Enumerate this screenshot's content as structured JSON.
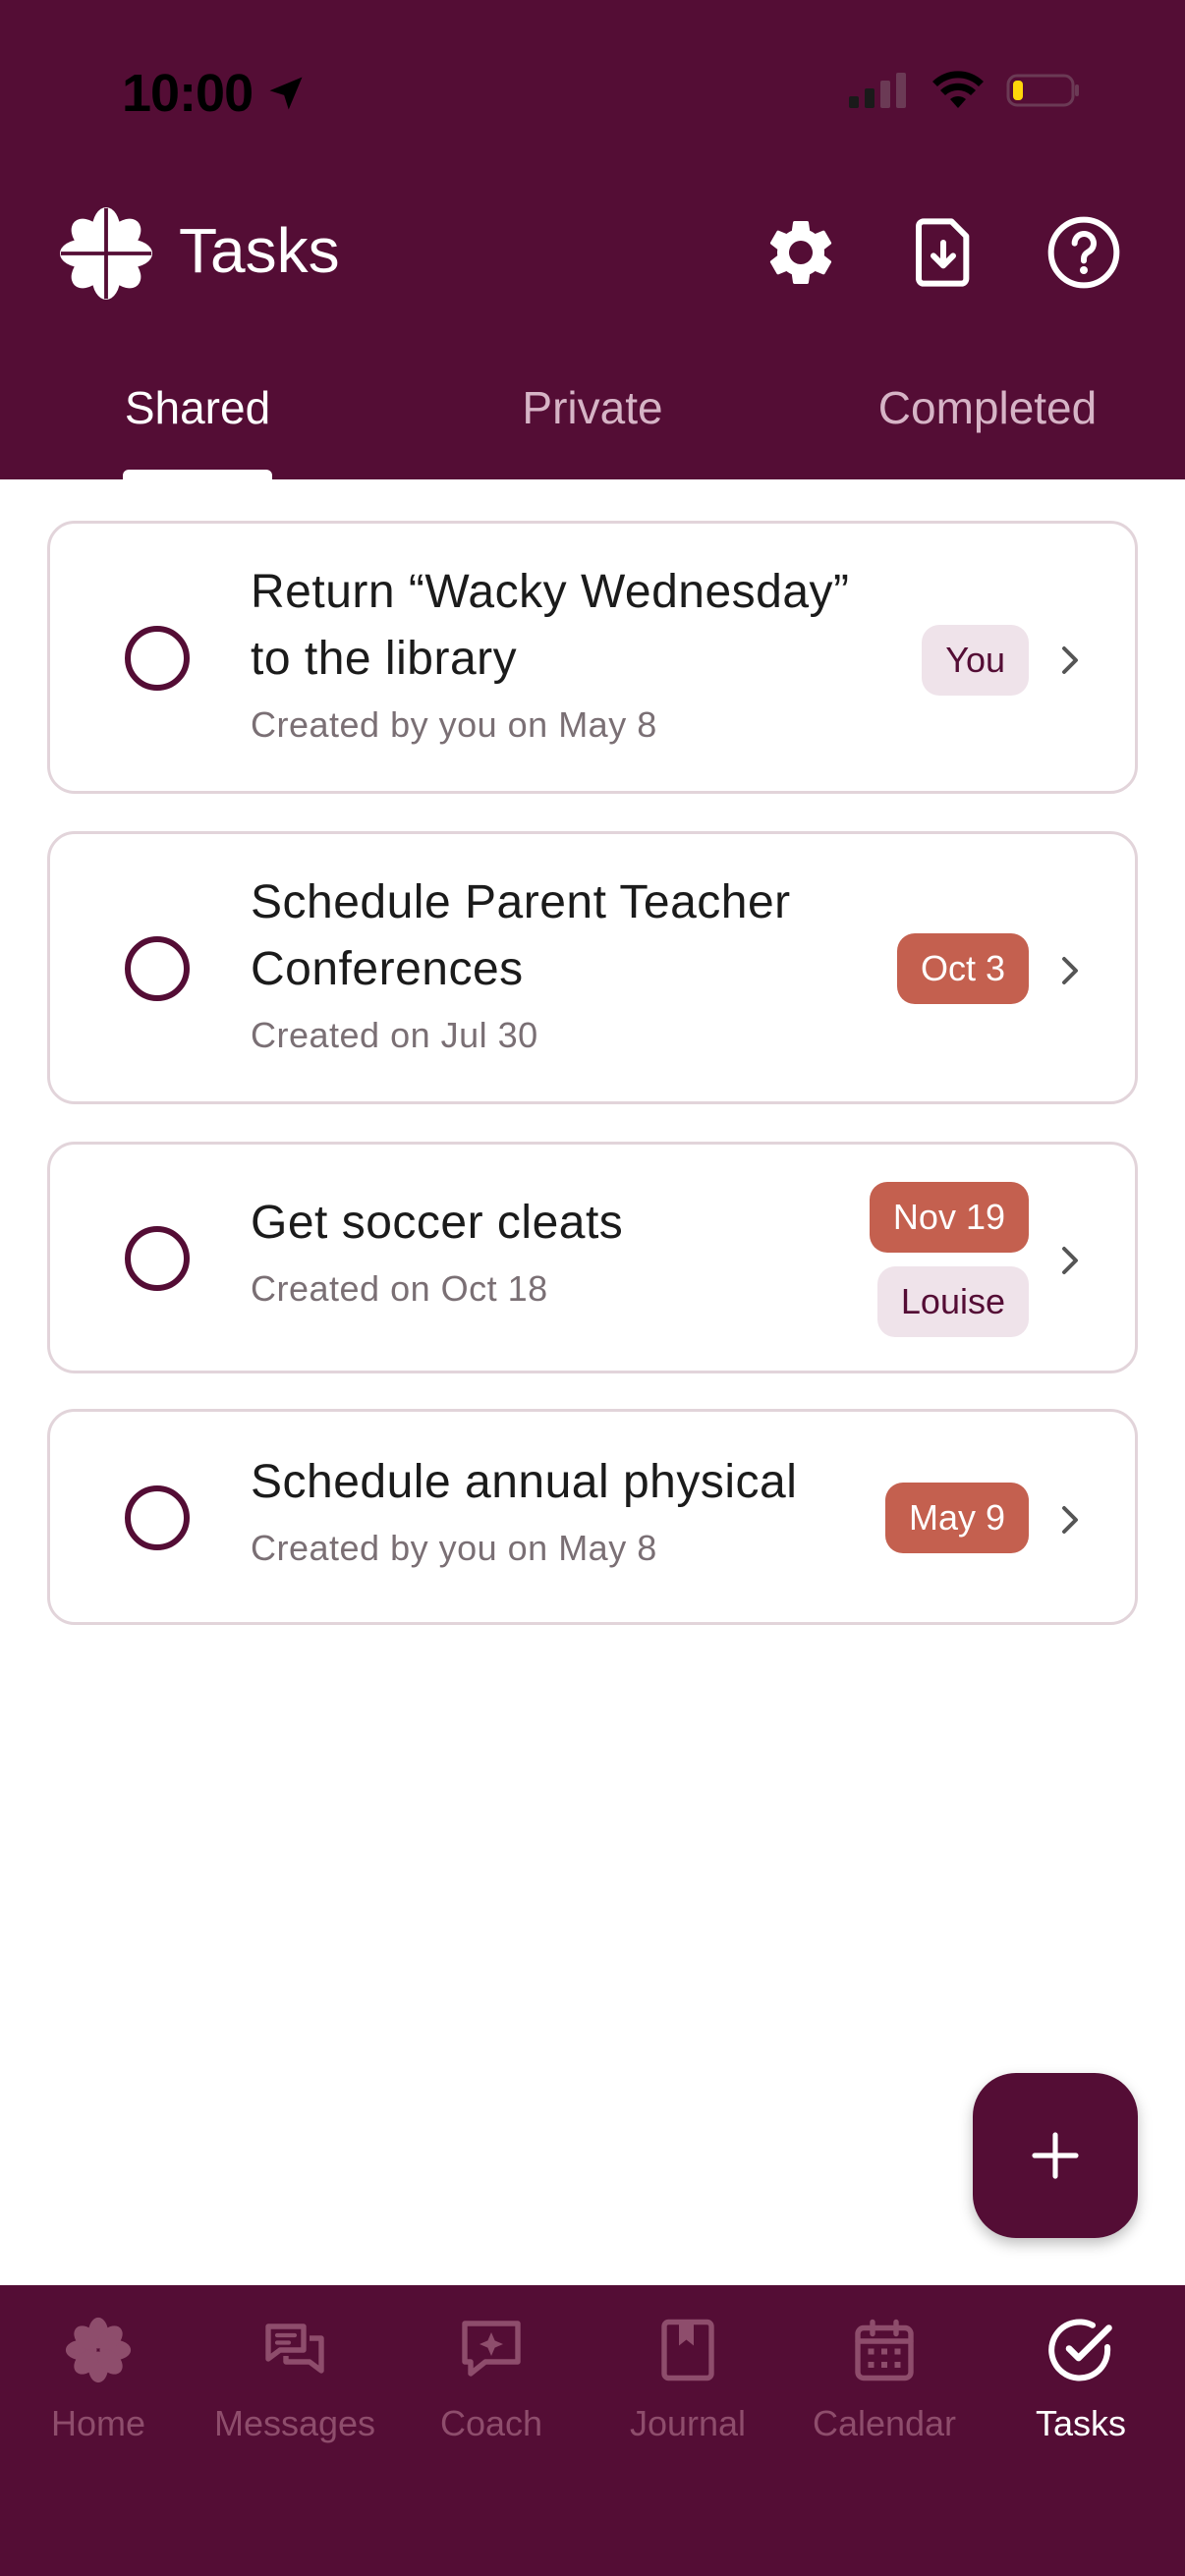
{
  "status_bar": {
    "time": "10:00"
  },
  "app_bar": {
    "title": "Tasks"
  },
  "tabs": [
    {
      "label": "Shared",
      "active": true
    },
    {
      "label": "Private",
      "active": false
    },
    {
      "label": "Completed",
      "active": false
    }
  ],
  "tasks": [
    {
      "title_line1": "Return “Wacky Wednesday”",
      "title_line2": "to the library",
      "subtitle": "Created by you on May 8",
      "assignee": "You",
      "due": ""
    },
    {
      "title_line1": "Schedule Parent Teacher",
      "title_line2": "Conferences",
      "subtitle": "Created on Jul 30",
      "assignee": "",
      "due": "Oct 3"
    },
    {
      "title_line1": "Get soccer cleats",
      "title_line2": "",
      "subtitle": "Created on Oct 18",
      "assignee": "Louise",
      "due": "Nov 19"
    },
    {
      "title_line1": "Schedule annual physical",
      "title_line2": "",
      "subtitle": "Created by you on May 8",
      "assignee": "",
      "due": "May 9"
    }
  ],
  "bottom_nav": [
    {
      "label": "Home",
      "icon": "flower-icon"
    },
    {
      "label": "Messages",
      "icon": "messages-icon"
    },
    {
      "label": "Coach",
      "icon": "coach-icon"
    },
    {
      "label": "Journal",
      "icon": "journal-icon"
    },
    {
      "label": "Calendar",
      "icon": "calendar-icon"
    },
    {
      "label": "Tasks",
      "icon": "check-circle-icon",
      "active": true
    }
  ],
  "colors": {
    "brand": "#540d35",
    "date_badge": "#c4604f",
    "person_badge_bg": "#efe3ea",
    "nav_inactive": "#8e4d6c"
  }
}
